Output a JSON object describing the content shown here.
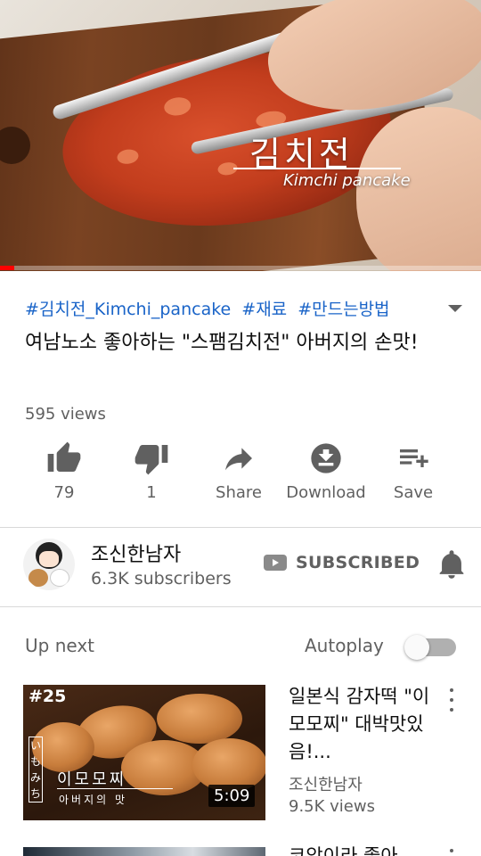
{
  "player": {
    "overlay_korean": "김치전",
    "overlay_english": "Kimchi pancake",
    "progress_fraction": 0.03
  },
  "video": {
    "hashtags": [
      "#김치전_Kimchi_pancake",
      "#재료",
      "#만드는방법"
    ],
    "title": "여남노소 좋아하는 \"스팸김치전\" 아버지의 손맛!",
    "views": "595 views"
  },
  "actions": {
    "like_count": "79",
    "dislike_count": "1",
    "share_label": "Share",
    "download_label": "Download",
    "save_label": "Save"
  },
  "channel": {
    "name": "조신한남자",
    "subscribers": "6.3K subscribers",
    "subscribe_label": "SUBSCRIBED"
  },
  "up_next": {
    "heading": "Up next",
    "autoplay_label": "Autoplay",
    "autoplay_on": false,
    "items": [
      {
        "title": "일본식 감자떡 \"이모모찌\" 대박맛있음!...",
        "channel": "조신한남자",
        "views": "9.5K views",
        "duration": "5:09",
        "thumb_episode": "#25",
        "thumb_vertical": "いもみち",
        "thumb_big": "이모모찌",
        "thumb_small": "아버지의 맛"
      },
      {
        "title": "코앞이라 좋아"
      }
    ]
  },
  "icons": {
    "like": "thumbs-up-icon",
    "dislike": "thumbs-down-icon",
    "share": "share-arrow-icon",
    "download": "download-circle-icon",
    "save": "playlist-add-icon",
    "bell": "bell-icon",
    "expand": "chevron-down-icon",
    "more": "kebab-menu-icon"
  },
  "colors": {
    "hashtag": "#1a64c8",
    "progress": "#ff0000",
    "secondary_text": "#606060"
  }
}
